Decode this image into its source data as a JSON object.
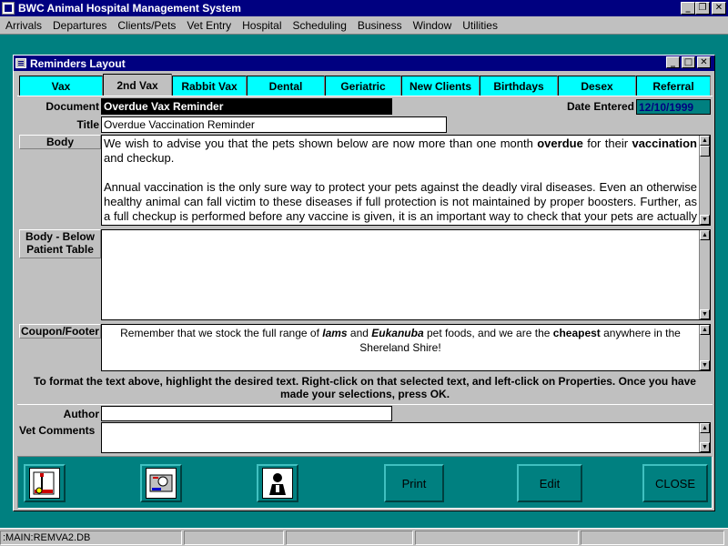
{
  "app": {
    "title": "BWC Animal Hospital Management System"
  },
  "window_controls": {
    "minimize": "_",
    "restore": "❐",
    "close": "✕"
  },
  "menu": [
    "Arrivals",
    "Departures",
    "Clients/Pets",
    "Vet Entry",
    "Hospital",
    "Scheduling",
    "Business",
    "Window",
    "Utilities"
  ],
  "dialog": {
    "title": "Reminders Layout",
    "controls": {
      "minimize": "_",
      "maximize": "□",
      "close": "✕"
    }
  },
  "tabs": [
    "Vax",
    "2nd Vax",
    "Rabbit Vax",
    "Dental",
    "Geriatric",
    "New Clients",
    "Birthdays",
    "Desex",
    "Referral"
  ],
  "active_tab": "2nd Vax",
  "form": {
    "document_label": "Document",
    "document_value": "Overdue Vax Reminder",
    "date_entered_label": "Date Entered",
    "date_entered_value": "12/10/1999",
    "title_label": "Title",
    "title_value": "Overdue Vaccination Reminder",
    "body_label": "Body",
    "body_text": {
      "p1_a": "We wish to advise you that the pets shown below are now more than one month ",
      "p1_b": "overdue",
      "p1_c": " for their ",
      "p1_d": "vaccination",
      "p1_e": " and checkup.",
      "p2": "Annual vaccination is the only sure way to protect your pets against the deadly viral diseases. Even an otherwise healthy animal can fall victim to these diseases if full protection is not maintained by proper boosters. Further, as a full checkup is performed before any vaccine is given, it is an important way to check that your pets are actually as healthy as they seem."
    },
    "body_below_label": "Body - Below Patient Table",
    "body_below_text": "",
    "coupon_label": "Coupon/Footer",
    "coupon_text": {
      "a": "Remember that we stock the full range of ",
      "b": "Iams",
      "c": " and ",
      "d": "Eukanuba",
      "e": " pet foods, and we are the ",
      "f": "cheapest",
      "g": " anywhere in the Shereland Shire!"
    },
    "instructions": "To format the text above, highlight the desired text.  Right-click on that selected text, and left-click on Properties.  Once you have made your selections, press OK.",
    "author_label": "Author",
    "author_value": "",
    "vet_comments_label": "Vet Comments",
    "vet_comments_value": ""
  },
  "buttons": {
    "icon1": "edit-document-icon",
    "icon2": "preview-icon",
    "icon3": "person-icon",
    "print": "Print",
    "edit": "Edit",
    "close": "CLOSE"
  },
  "status": {
    "path": ":MAIN:REMVA2.DB"
  },
  "colors": {
    "desktop": "#008080",
    "titlebar": "#000080",
    "tab": "#00ffff",
    "face": "#c0c0c0"
  }
}
